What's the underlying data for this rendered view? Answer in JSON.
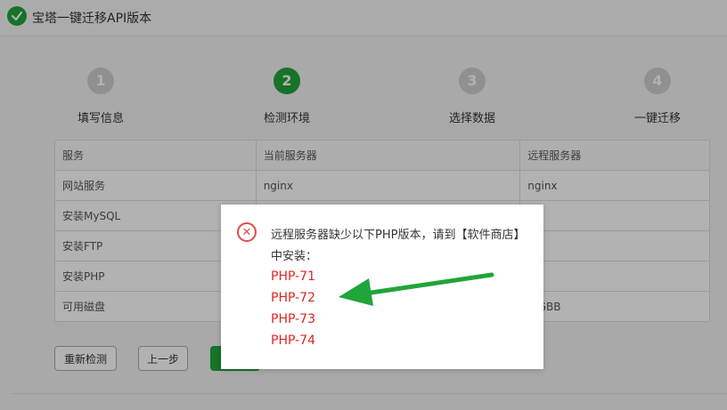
{
  "window": {
    "title": "宝塔一键迁移API版本"
  },
  "steps": [
    {
      "number": "1",
      "label": "填写信息",
      "active": false
    },
    {
      "number": "2",
      "label": "检测环境",
      "active": true
    },
    {
      "number": "3",
      "label": "选择数据",
      "active": false
    },
    {
      "number": "4",
      "label": "一键迁移",
      "active": false
    }
  ],
  "table": {
    "headers": [
      "服务",
      "当前服务器",
      "远程服务器"
    ],
    "rows": [
      [
        "网站服务",
        "nginx",
        "nginx"
      ],
      [
        "安装MySQL",
        "",
        ""
      ],
      [
        "安装FTP",
        "",
        ""
      ],
      [
        "安装PHP",
        "",
        ""
      ],
      [
        "可用磁盘",
        "",
        "5 GBB"
      ]
    ]
  },
  "buttons": {
    "recheck": "重新检测",
    "prev": "上一步",
    "next": ""
  },
  "modal": {
    "message": "远程服务器缺少以下PHP版本，请到【软件商店】中安装：",
    "missing": [
      "PHP-71",
      "PHP-72",
      "PHP-73",
      "PHP-74"
    ]
  },
  "colors": {
    "accent": "#20a53a",
    "error": "#e02424",
    "arrow": "#20a53a"
  },
  "icons": {
    "title": "check-icon",
    "modal": "close-circle-icon"
  }
}
